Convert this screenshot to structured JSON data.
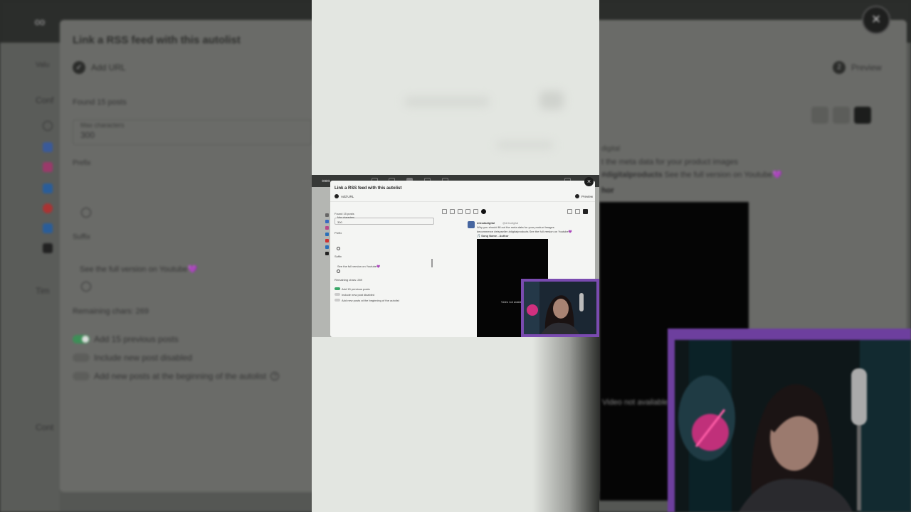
{
  "app": {
    "logo": "∞"
  },
  "modal": {
    "title": "Link a RSS feed with this autolist",
    "step1": "Add URL",
    "step2_number": "2",
    "step2": "Preview",
    "close_symbol": "×"
  },
  "form": {
    "found_posts": "Found 15 posts",
    "max_chars_label": "Max characters",
    "max_chars_value": "300",
    "prefix_label": "Prefix",
    "suffix_label": "Suffix",
    "suffix_value": "See the full version on Youtube💜",
    "remaining": "Remaining chars: 269",
    "options": [
      {
        "label": "Add 15 previous posts",
        "checked": true
      },
      {
        "label": "Include new post disabled",
        "checked": false
      },
      {
        "label": "Add new posts at the beginning of the autolist",
        "checked": false
      }
    ],
    "help_symbol": "?"
  },
  "sidebar_bg": {
    "conf": "Conf",
    "tim": "Tim",
    "cont": "Cont",
    "val": "Valu"
  },
  "preview": {
    "handle": "digital",
    "line1": "t the meta data for your product images",
    "line2_tags": "#digitalproducts",
    "line2_rest": "See the full version on Youtube💜",
    "song_label": "hor",
    "video_message": "Video not available"
  },
  "mini": {
    "logo": "∞∞",
    "close": "×",
    "title": "Link a RSS feed with this autolist",
    "step1": "Add URL",
    "step2": "Preview",
    "found": "Found 15 posts",
    "max_label": "Max characters",
    "max_value": "300",
    "prefix": "Prefix",
    "suffix": "Suffix",
    "suffix_value": "See the full version on Youtube💜",
    "remaining": "Remaining chars: 269",
    "opt1": "Add 15 previous posts",
    "opt2": "Include new post disabled",
    "opt3": "Add new posts at the beginning of the autolist",
    "author": "drbsdadigital",
    "author_handle": "@drbsdigital",
    "post_line1": "Why you should fill out the meta data for your product images",
    "post_line2": "#ecommerce #etsyseller #digitalproducts See the full version on Youtube💜",
    "song": "🎵 Song Name - Author",
    "video_message": "Video not available"
  },
  "colors": {
    "toggle_on": "#3aa869",
    "webcam_frame": "#7a4bb0",
    "center_bg": "#e3e6e1"
  }
}
